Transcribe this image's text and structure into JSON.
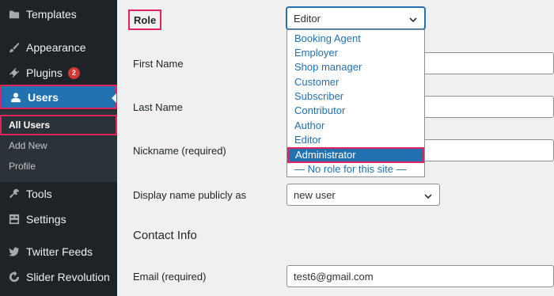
{
  "sidebar": {
    "templates": "Templates",
    "appearance": "Appearance",
    "plugins": "Plugins",
    "plugins_badge": "2",
    "users": "Users",
    "submenu": {
      "all_users": "All Users",
      "add_new": "Add New",
      "profile": "Profile"
    },
    "tools": "Tools",
    "settings": "Settings",
    "twitter_feeds": "Twitter Feeds",
    "slider_revolution": "Slider Revolution"
  },
  "form": {
    "role_label": "Role",
    "role_value": "Editor",
    "role_options": [
      "Booking Agent",
      "Employer",
      "Shop manager",
      "Customer",
      "Subscriber",
      "Contributor",
      "Author",
      "Editor",
      "Administrator",
      "— No role for this site —"
    ],
    "first_name_label": "First Name",
    "last_name_label": "Last Name",
    "nickname_label": "Nickname (required)",
    "display_name_label": "Display name publicly as",
    "display_name_value": "new user",
    "contact_info_title": "Contact Info",
    "email_label": "Email (required)",
    "email_value": "test6@gmail.com"
  },
  "colors": {
    "sidebar_bg": "#1d2327",
    "accent": "#2271b1",
    "highlight": "#e0245e"
  }
}
